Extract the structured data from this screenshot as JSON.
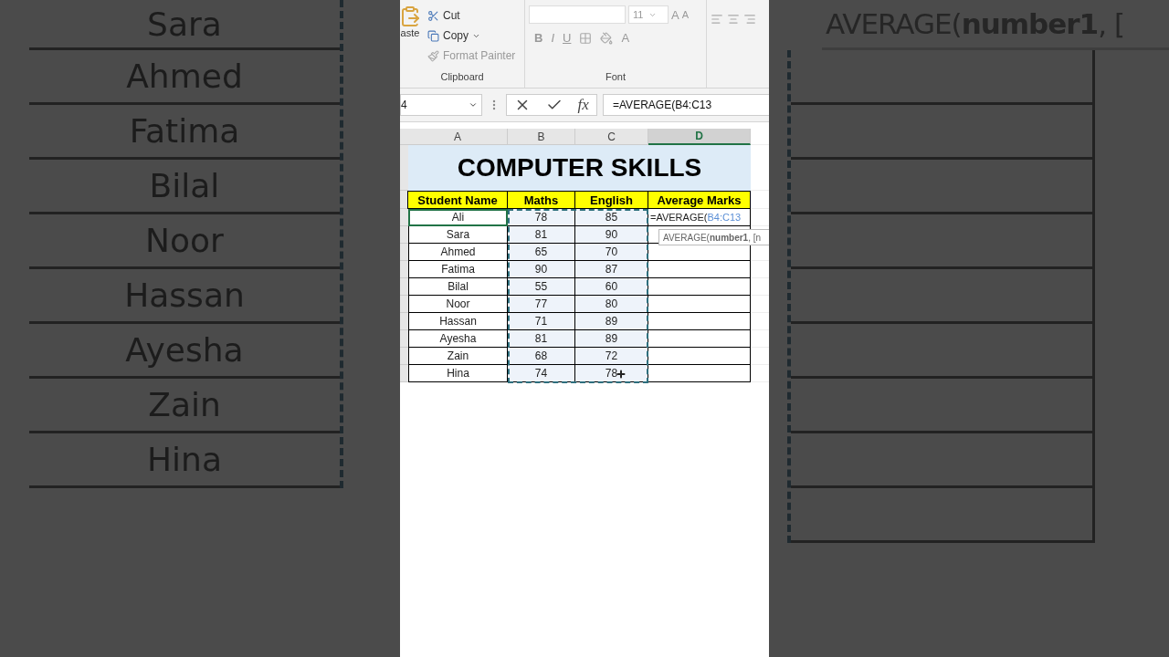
{
  "backdrop": {
    "names": [
      "Sara",
      "Ahmed",
      "Fatima",
      "Bilal",
      "Noor",
      "Hassan",
      "Ayesha",
      "Zain",
      "Hina"
    ],
    "tooltip": "AVERAGE(**number1**, ["
  },
  "ribbon": {
    "clipboard": {
      "paste": "aste",
      "cut": "Cut",
      "copy": "Copy",
      "format_painter": "Format Painter",
      "label": "Clipboard"
    },
    "font": {
      "size": "11",
      "grow": "A",
      "shrink": "A",
      "bold": "B",
      "italic": "I",
      "underline": "U",
      "font_color": "A",
      "label": "Font"
    }
  },
  "formula_bar": {
    "name_box": "4",
    "fx": "fx",
    "formula": "=AVERAGE(B4:C13"
  },
  "sheet": {
    "columns": [
      {
        "label": "A",
        "selected": false
      },
      {
        "label": "B",
        "selected": false
      },
      {
        "label": "C",
        "selected": false
      },
      {
        "label": "D",
        "selected": true
      }
    ],
    "title": "COMPUTER SKILLS",
    "headers": [
      "Student Name",
      "Maths",
      "English",
      "Average Marks"
    ],
    "rows": [
      {
        "name": "Ali",
        "maths": "78",
        "english": "85",
        "active": true
      },
      {
        "name": "Sara",
        "maths": "81",
        "english": "90",
        "active": false
      },
      {
        "name": "Ahmed",
        "maths": "65",
        "english": "70",
        "active": false
      },
      {
        "name": "Fatima",
        "maths": "90",
        "english": "87",
        "active": false
      },
      {
        "name": "Bilal",
        "maths": "55",
        "english": "60",
        "active": false
      },
      {
        "name": "Noor",
        "maths": "77",
        "english": "80",
        "active": false
      },
      {
        "name": "Hassan",
        "maths": "71",
        "english": "89",
        "active": false
      },
      {
        "name": "Ayesha",
        "maths": "81",
        "english": "89",
        "active": false
      },
      {
        "name": "Zain",
        "maths": "68",
        "english": "72",
        "active": false
      },
      {
        "name": "Hina",
        "maths": "74",
        "english": "78",
        "active": false
      }
    ],
    "editing_cell": {
      "prefix": "=AVERAGE(",
      "reference": "B4:C13"
    },
    "tooltip": "AVERAGE(**number1**, [n"
  }
}
